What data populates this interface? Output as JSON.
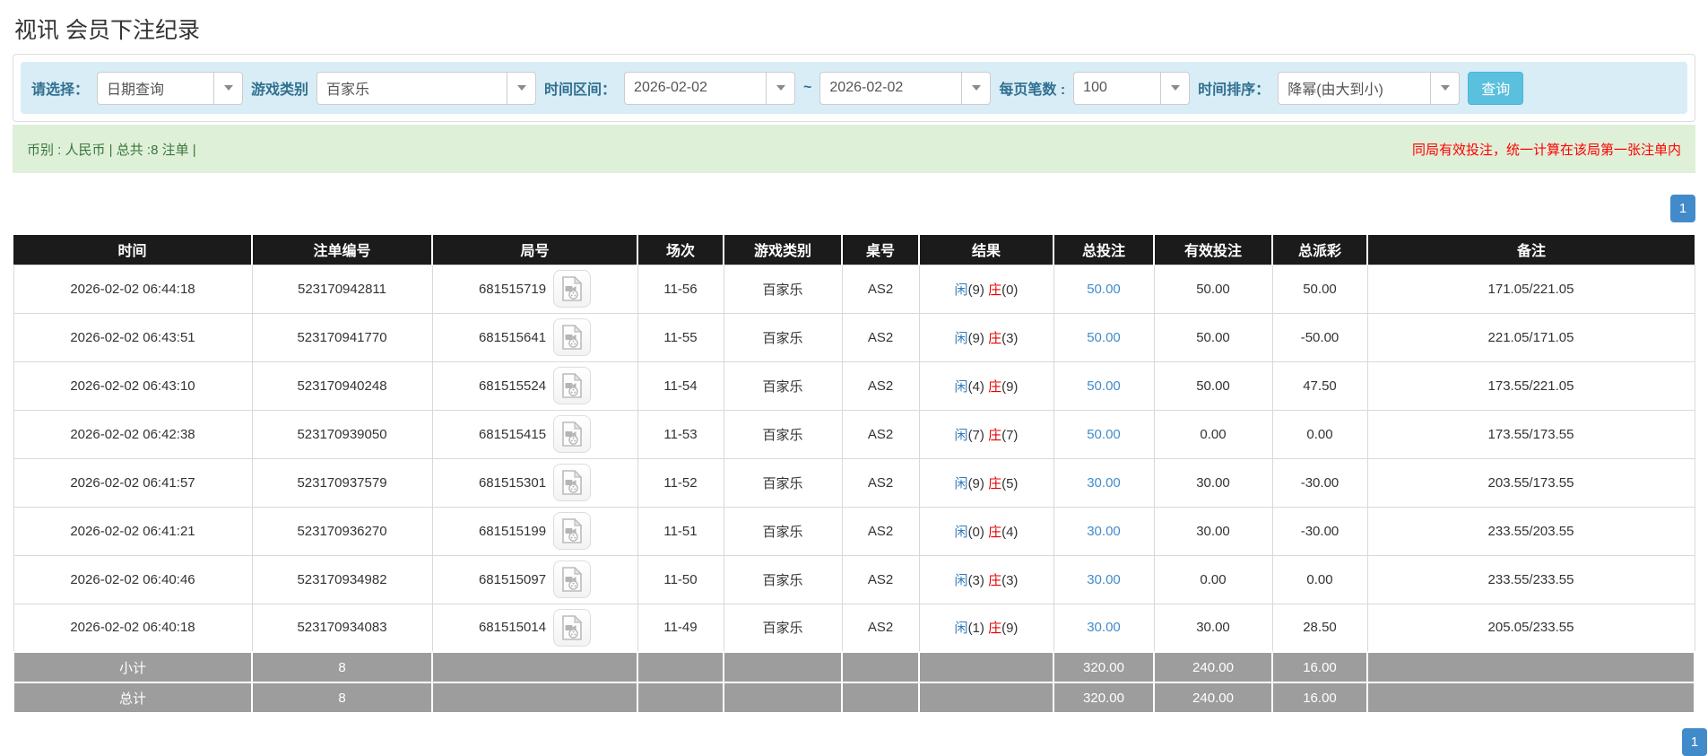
{
  "page": {
    "title": "视讯 会员下注纪录"
  },
  "filters": {
    "select_label": "请选择：",
    "select_value": "日期查询",
    "game_type_label": "游戏类别",
    "game_type_value": "百家乐",
    "date_range_label": "时间区间：",
    "date_from": "2026-02-02",
    "date_separator": "~",
    "date_to": "2026-02-02",
    "page_size_label": "每页笔数 :",
    "page_size_value": "100",
    "sort_label": "时间排序：",
    "sort_value": "降幂(由大到小)",
    "search_button": "查询"
  },
  "summary": {
    "left_text": "币别 : 人民币 | 总共 :8 注单 |",
    "right_note": "同局有效投注，统一计算在该局第一张注单内"
  },
  "pagination": {
    "current_page": "1"
  },
  "colors": {
    "header_bg": "#1b1b1b",
    "filter_bg": "#d9edf7",
    "summary_bg": "#dff0d8",
    "accent_blue": "#428bca",
    "search_btn": "#5bc0de",
    "negative_red": "#e60000",
    "subtotal_grey": "#9d9d9d"
  },
  "icons": {
    "video_icon": "video-file-icon",
    "dropdown_icon": "chevron-down-icon"
  },
  "table": {
    "headers": [
      "时间",
      "注单编号",
      "局号",
      "场次",
      "游戏类别",
      "桌号",
      "结果",
      "总投注",
      "有效投注",
      "总派彩",
      "备注"
    ],
    "rows": [
      {
        "time": "2026-02-02 06:44:18",
        "bet_id": "523170942811",
        "round_id": "681515719",
        "session": "11-56",
        "game": "百家乐",
        "table_no": "AS2",
        "result": {
          "player_label": "闲",
          "player_score": "(9)",
          "banker_label": "庄",
          "banker_score": "(0)"
        },
        "total_bet": "50.00",
        "valid_bet": "50.00",
        "payout": "50.00",
        "note": "171.05/221.05"
      },
      {
        "time": "2026-02-02 06:43:51",
        "bet_id": "523170941770",
        "round_id": "681515641",
        "session": "11-55",
        "game": "百家乐",
        "table_no": "AS2",
        "result": {
          "player_label": "闲",
          "player_score": "(9)",
          "banker_label": "庄",
          "banker_score": "(3)"
        },
        "total_bet": "50.00",
        "valid_bet": "50.00",
        "payout": "-50.00",
        "note": "221.05/171.05"
      },
      {
        "time": "2026-02-02 06:43:10",
        "bet_id": "523170940248",
        "round_id": "681515524",
        "session": "11-54",
        "game": "百家乐",
        "table_no": "AS2",
        "result": {
          "player_label": "闲",
          "player_score": "(4)",
          "banker_label": "庄",
          "banker_score": "(9)"
        },
        "total_bet": "50.00",
        "valid_bet": "50.00",
        "payout": "47.50",
        "note": "173.55/221.05"
      },
      {
        "time": "2026-02-02 06:42:38",
        "bet_id": "523170939050",
        "round_id": "681515415",
        "session": "11-53",
        "game": "百家乐",
        "table_no": "AS2",
        "result": {
          "player_label": "闲",
          "player_score": "(7)",
          "banker_label": "庄",
          "banker_score": "(7)"
        },
        "total_bet": "50.00",
        "valid_bet": "0.00",
        "payout": "0.00",
        "note": "173.55/173.55"
      },
      {
        "time": "2026-02-02 06:41:57",
        "bet_id": "523170937579",
        "round_id": "681515301",
        "session": "11-52",
        "game": "百家乐",
        "table_no": "AS2",
        "result": {
          "player_label": "闲",
          "player_score": "(9)",
          "banker_label": "庄",
          "banker_score": "(5)"
        },
        "total_bet": "30.00",
        "valid_bet": "30.00",
        "payout": "-30.00",
        "note": "203.55/173.55"
      },
      {
        "time": "2026-02-02 06:41:21",
        "bet_id": "523170936270",
        "round_id": "681515199",
        "session": "11-51",
        "game": "百家乐",
        "table_no": "AS2",
        "result": {
          "player_label": "闲",
          "player_score": "(0)",
          "banker_label": "庄",
          "banker_score": "(4)"
        },
        "total_bet": "30.00",
        "valid_bet": "30.00",
        "payout": "-30.00",
        "note": "233.55/203.55"
      },
      {
        "time": "2026-02-02 06:40:46",
        "bet_id": "523170934982",
        "round_id": "681515097",
        "session": "11-50",
        "game": "百家乐",
        "table_no": "AS2",
        "result": {
          "player_label": "闲",
          "player_score": "(3)",
          "banker_label": "庄",
          "banker_score": "(3)"
        },
        "total_bet": "30.00",
        "valid_bet": "0.00",
        "payout": "0.00",
        "note": "233.55/233.55"
      },
      {
        "time": "2026-02-02 06:40:18",
        "bet_id": "523170934083",
        "round_id": "681515014",
        "session": "11-49",
        "game": "百家乐",
        "table_no": "AS2",
        "result": {
          "player_label": "闲",
          "player_score": "(1)",
          "banker_label": "庄",
          "banker_score": "(9)"
        },
        "total_bet": "30.00",
        "valid_bet": "30.00",
        "payout": "28.50",
        "note": "205.05/233.55"
      }
    ],
    "subtotal": {
      "label": "小计",
      "count": "8",
      "total_bet": "320.00",
      "valid_bet": "240.00",
      "payout": "16.00"
    },
    "total": {
      "label": "总计",
      "count": "8",
      "total_bet": "320.00",
      "valid_bet": "240.00",
      "payout": "16.00"
    }
  }
}
